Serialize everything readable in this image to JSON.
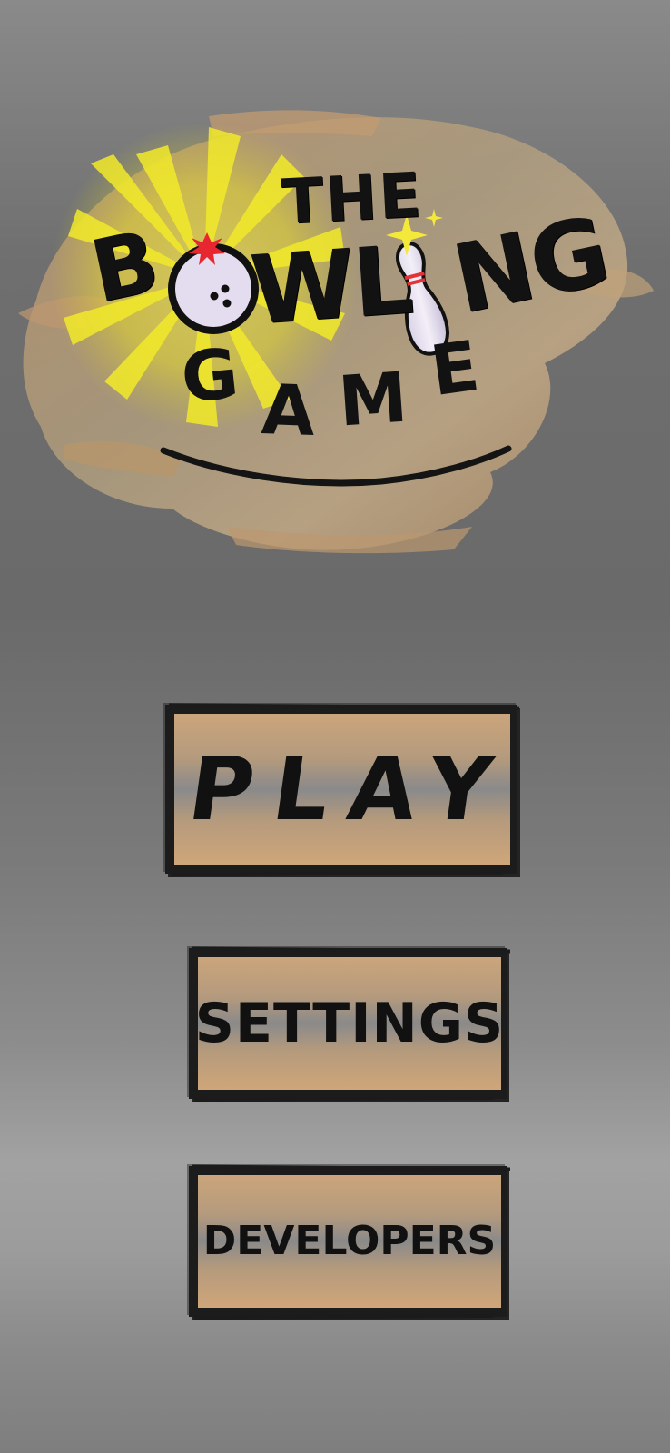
{
  "logo": {
    "line1": "THE",
    "letter_b": "B",
    "letters_wl": "WL",
    "letters_ng": "NG",
    "game_letters": [
      "G",
      "A",
      "M",
      "E"
    ],
    "icons": [
      "bowling-ball-icon",
      "bowling-pin-icon",
      "sparkle-icon",
      "burst-icon"
    ]
  },
  "menu": {
    "play_label": "PLAY",
    "settings_label": "SETTINGS",
    "developers_label": "DEVELOPERS"
  },
  "colors": {
    "button_tan": "#cba57c",
    "button_border": "#1c1c1c",
    "background_gray": "#6f6f6f",
    "sunburst_yellow": "#f2ea2a",
    "ball_fill": "#e4dcef",
    "burst_red": "#e8262f",
    "pin_stripe": "#e23434"
  }
}
